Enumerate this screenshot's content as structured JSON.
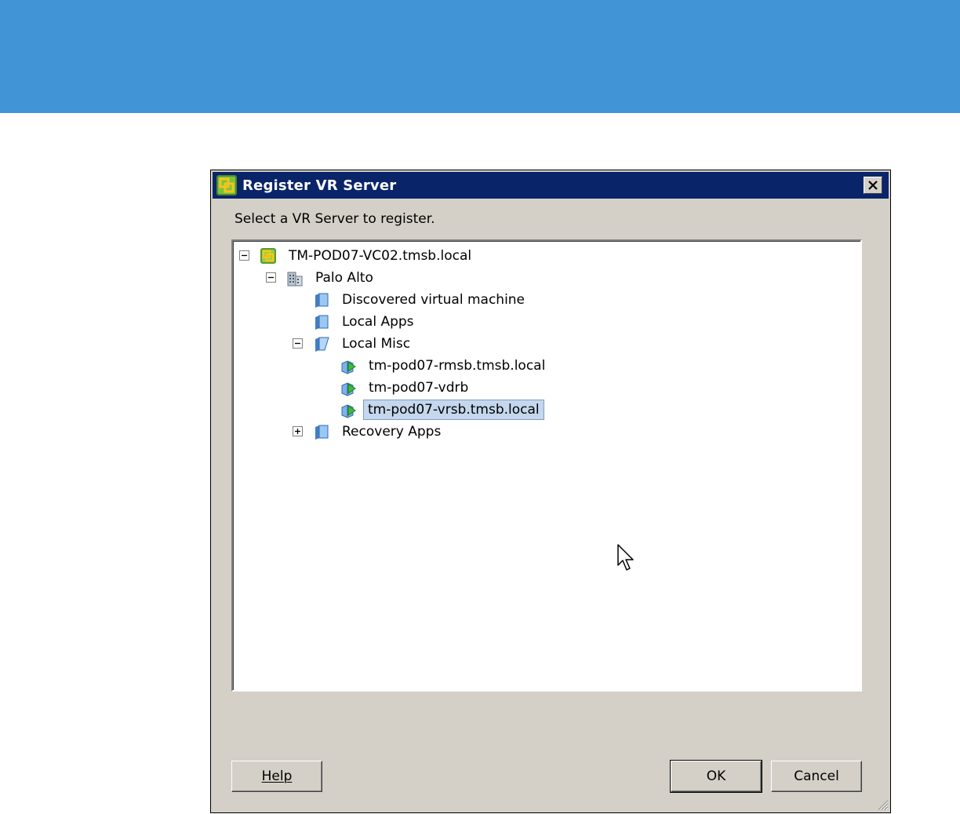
{
  "banner": {
    "color": "#4195d6"
  },
  "dialog": {
    "title": "Register VR Server",
    "close_glyph": "×",
    "prompt": "Select a VR Server to register."
  },
  "tree": {
    "root": {
      "label": "TM-POD07-VC02.tmsb.local",
      "expanded": true,
      "icon": "vcenter-icon"
    },
    "datacenter": {
      "label": "Palo Alto",
      "expanded": true,
      "icon": "datacenter-icon"
    },
    "folders": [
      {
        "label": "Discovered virtual machine",
        "icon": "folder-icon"
      },
      {
        "label": "Local Apps",
        "icon": "folder-icon"
      },
      {
        "label": "Local Misc",
        "icon": "folder-open-icon",
        "expanded": true
      },
      {
        "label": "Recovery Apps",
        "icon": "folder-icon",
        "expanded": false
      }
    ],
    "vms": [
      {
        "label": "tm-pod07-rmsb.tmsb.local",
        "icon": "vm-icon",
        "selected": false
      },
      {
        "label": "tm-pod07-vdrb",
        "icon": "vm-icon",
        "selected": false
      },
      {
        "label": "tm-pod07-vrsb.tmsb.local",
        "icon": "vm-icon",
        "selected": true
      }
    ]
  },
  "buttons": {
    "help": "Help",
    "ok": "OK",
    "cancel": "Cancel"
  }
}
